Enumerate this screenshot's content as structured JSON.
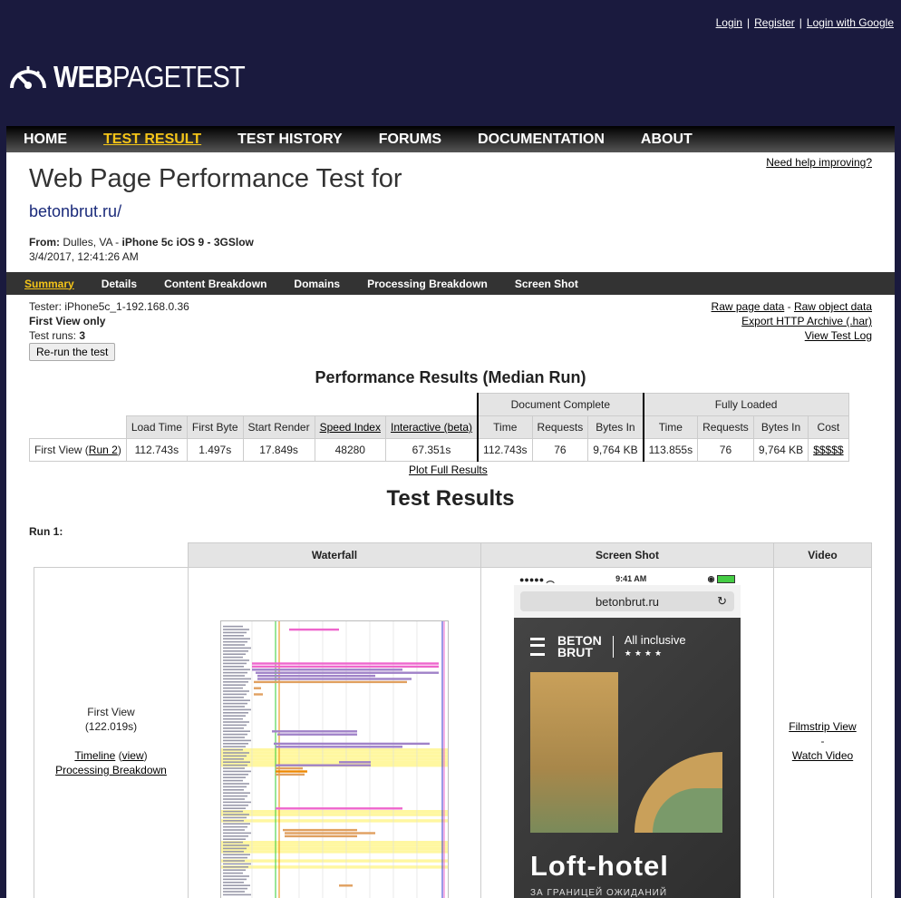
{
  "header": {
    "login": "Login",
    "register": "Register",
    "login_google": "Login with Google",
    "separator": "|",
    "logo_bold": "WEB",
    "logo_rest": "PAGETEST"
  },
  "nav": {
    "home": "HOME",
    "test_result": "TEST RESULT",
    "test_history": "TEST HISTORY",
    "forums": "FORUMS",
    "documentation": "DOCUMENTATION",
    "about": "ABOUT"
  },
  "page": {
    "help": "Need help improving?",
    "title": "Web Page Performance Test for",
    "url": "betonbrut.ru/",
    "from_label": "From:",
    "from_location": "Dulles, VA",
    "from_dash": " - ",
    "from_device": "iPhone 5c iOS 9 - 3GSlow",
    "date": "3/4/2017, 12:41:26 AM"
  },
  "subnav": {
    "summary": "Summary",
    "details": "Details",
    "content_breakdown": "Content Breakdown",
    "domains": "Domains",
    "processing_breakdown": "Processing Breakdown",
    "screen_shot": "Screen Shot"
  },
  "info": {
    "tester": "Tester: iPhone5c_1-192.168.0.36",
    "first_view_only": "First View only",
    "test_runs_label": "Test runs: ",
    "test_runs_value": "3",
    "rerun": "Re-run the test",
    "raw_page": "Raw page data",
    "dash": " - ",
    "raw_object": "Raw object data",
    "export_har": "Export HTTP Archive (.har)",
    "view_log": "View Test Log"
  },
  "perf": {
    "title": "Performance Results (Median Run)",
    "group_doc": "Document Complete",
    "group_full": "Fully Loaded",
    "headers": {
      "load_time": "Load Time",
      "first_byte": "First Byte",
      "start_render": "Start Render",
      "speed_index": "Speed Index",
      "interactive": "Interactive (beta)",
      "doc_time": "Time",
      "doc_requests": "Requests",
      "doc_bytes": "Bytes In",
      "full_time": "Time",
      "full_requests": "Requests",
      "full_bytes": "Bytes In",
      "cost": "Cost"
    },
    "row": {
      "label": "First View (",
      "run_link": "Run 2",
      "label_end": ")",
      "load_time": "112.743s",
      "first_byte": "1.497s",
      "start_render": "17.849s",
      "speed_index": "48280",
      "interactive": "67.351s",
      "doc_time": "112.743s",
      "doc_requests": "76",
      "doc_bytes": "9,764 KB",
      "full_time": "113.855s",
      "full_requests": "76",
      "full_bytes": "9,764 KB",
      "cost": "$$$$$"
    },
    "plot_full": "Plot Full Results"
  },
  "results": {
    "title": "Test Results",
    "run_label": "Run 1:",
    "col_waterfall": "Waterfall",
    "col_screenshot": "Screen Shot",
    "col_video": "Video",
    "first_view": "First View",
    "first_view_time": "(122.019s)",
    "timeline": "Timeline",
    "view": "view",
    "processing_breakdown": "Processing Breakdown",
    "filmstrip": "Filmstrip View",
    "dash": "-",
    "watch_video": "Watch Video"
  },
  "screenshot": {
    "status_time": "9:41 AM",
    "url": "betonbrut.ru",
    "brand_line1": "BETON",
    "brand_line2": "BRUT",
    "tagline": "All inclusive",
    "stars": "★★★★",
    "headline": "Loft-hotel",
    "subline": "ЗА ГРАНИЦЕЙ ОЖИДАНИЙ"
  },
  "colors": {
    "background": "#1a1a3e",
    "nav_active": "#f5c518",
    "header_cell": "#e4e4e4",
    "waterfall_bar_purple": "#a082c8",
    "waterfall_bar_orange": "#e0a060",
    "waterfall_highlight": "#fff7a0",
    "marker_green": "#3c3",
    "marker_orange": "#e80",
    "marker_pink": "#e6c",
    "marker_blue": "#33c"
  }
}
